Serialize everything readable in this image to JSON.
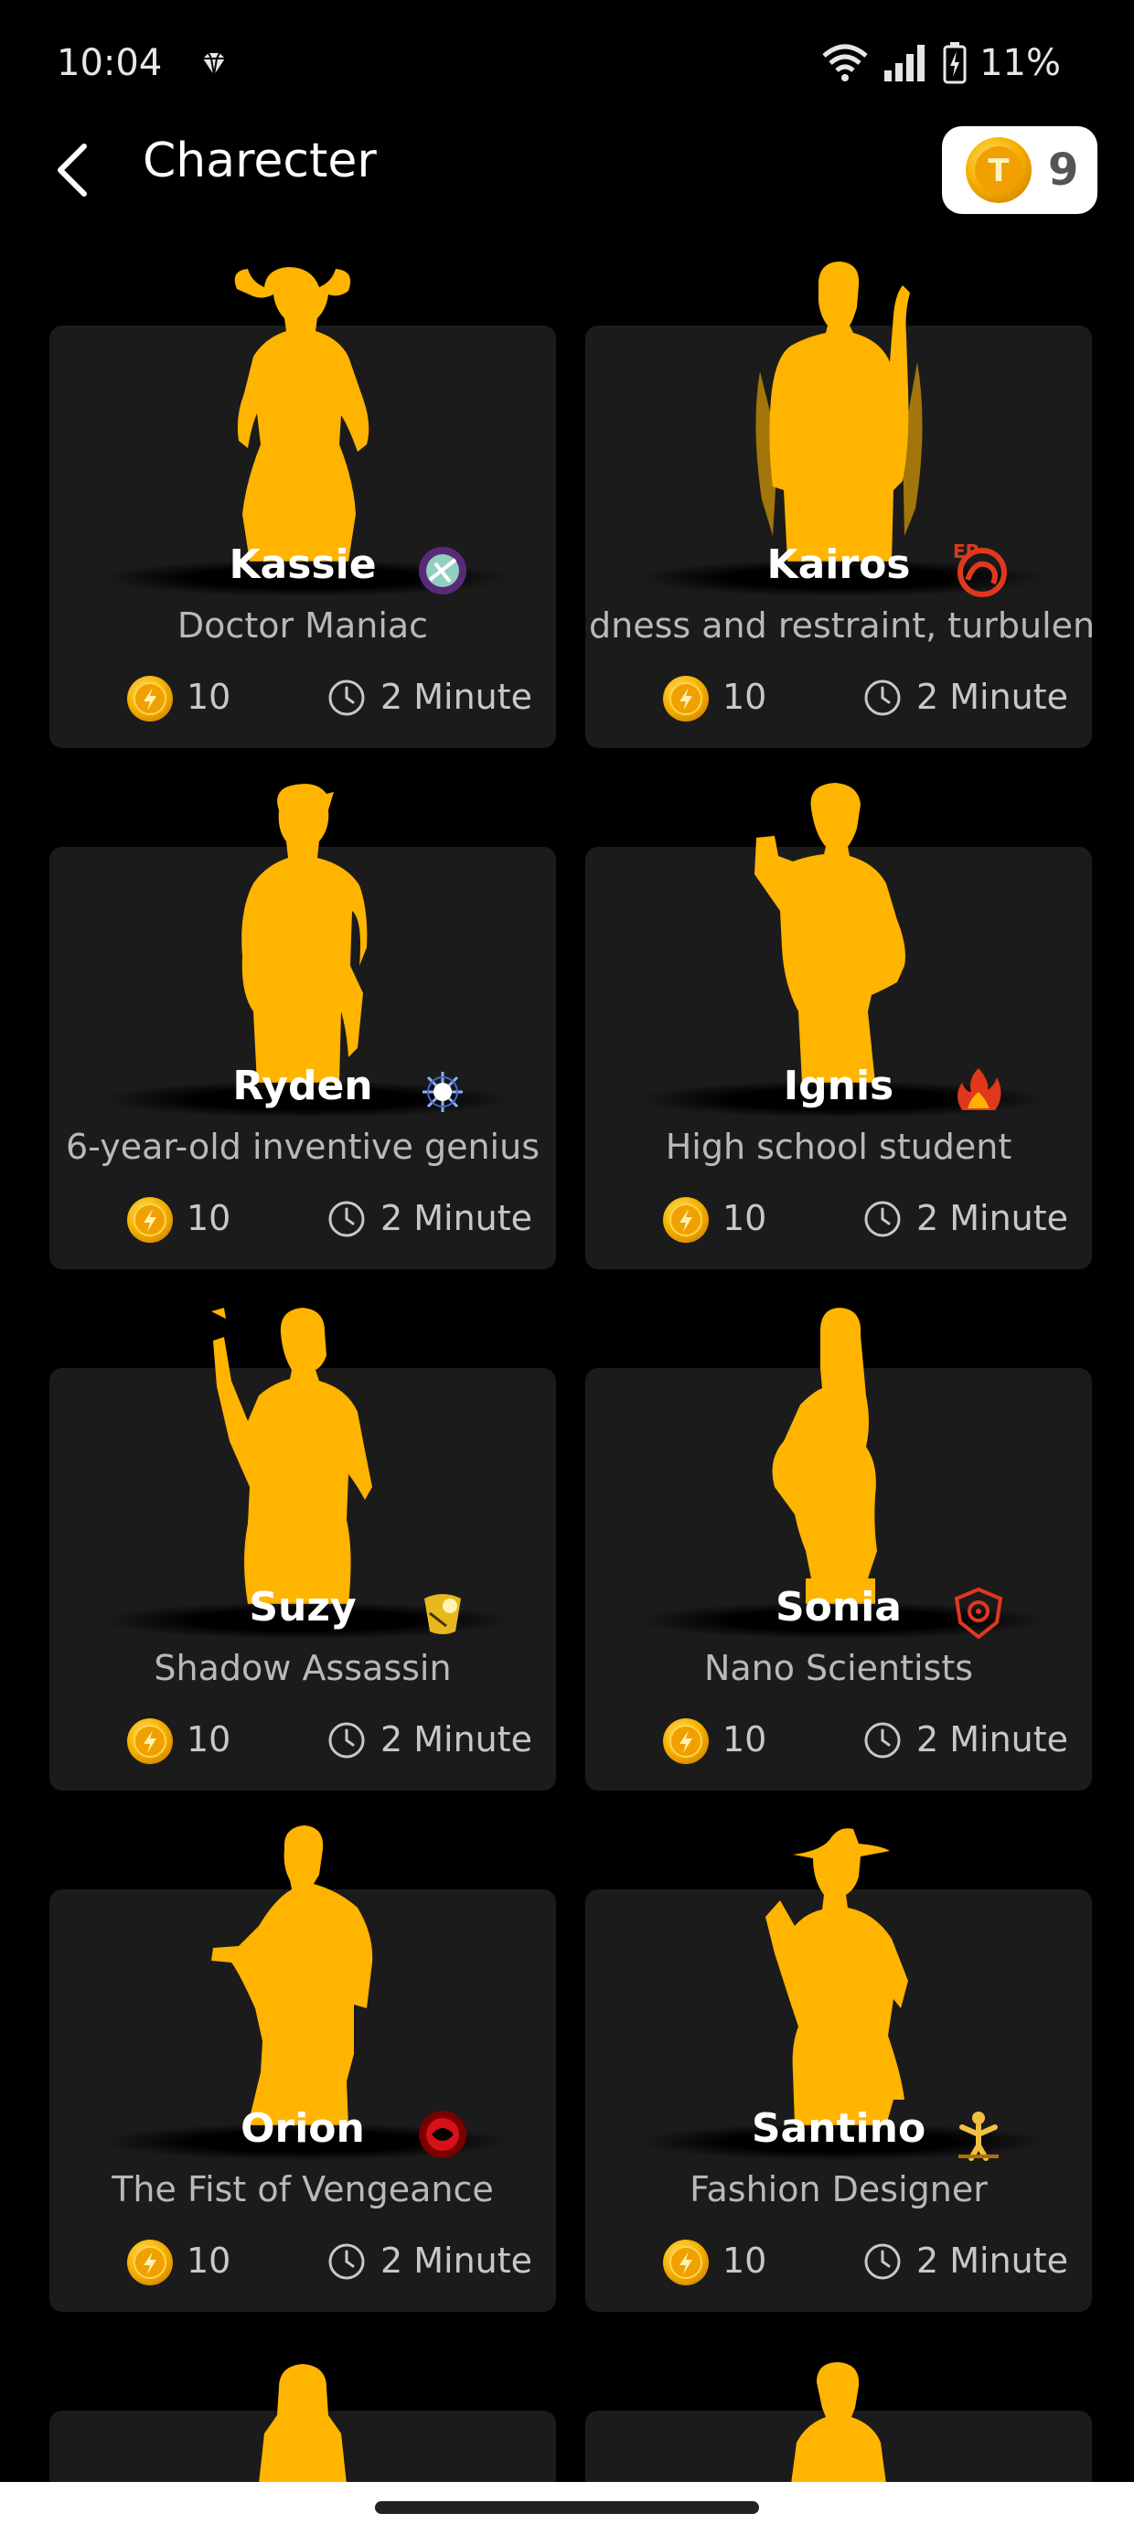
{
  "status": {
    "time": "10:04",
    "battery": "11%"
  },
  "header": {
    "title": "Charecter",
    "coins": "9"
  },
  "characters": [
    {
      "name": "Kassie",
      "desc": "Doctor Maniac",
      "price": "10",
      "duration": "2 Minute",
      "badge": "purple-orb-icon",
      "silhouette": "twin-tails-girl"
    },
    {
      "name": "Kairos",
      "desc": "dness and restraint, turbulen",
      "price": "10",
      "duration": "2 Minute",
      "badge": "ep-flame-icon",
      "silhouette": "flame-man"
    },
    {
      "name": "Ryden",
      "desc": "6-year-old inventive genius",
      "price": "10",
      "duration": "2 Minute",
      "badge": "spider-web-icon",
      "silhouette": "spiky-hair-boy"
    },
    {
      "name": "Ignis",
      "desc": "High school student",
      "price": "10",
      "duration": "2 Minute",
      "badge": "fire-icon",
      "silhouette": "pointing-boy"
    },
    {
      "name": "Suzy",
      "desc": "Shadow Assassin",
      "price": "10",
      "duration": "2 Minute",
      "badge": "scroll-icon",
      "silhouette": "ninja-girl"
    },
    {
      "name": "Sonia",
      "desc": "Nano Scientists",
      "price": "10",
      "duration": "2 Minute",
      "badge": "shield-icon",
      "silhouette": "ponytail-girl"
    },
    {
      "name": "Orion",
      "desc": "The Fist of Vengeance",
      "price": "10",
      "duration": "2 Minute",
      "badge": "red-ring-icon",
      "silhouette": "fighter-man"
    },
    {
      "name": "Santino",
      "desc": "Fashion Designer",
      "price": "10",
      "duration": "2 Minute",
      "badge": "gold-figure-icon",
      "silhouette": "hat-man"
    }
  ],
  "colors": {
    "silhouette": "#FFB400",
    "card": "#1B1B1C",
    "background": "#000000",
    "coin": "#F5A300"
  }
}
